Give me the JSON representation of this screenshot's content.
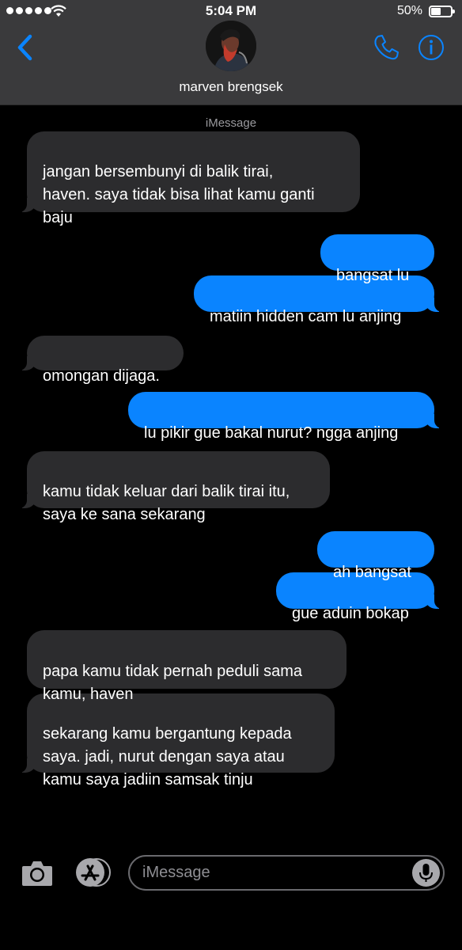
{
  "status_bar": {
    "time": "5:04 PM",
    "battery": "50%"
  },
  "header": {
    "contact_name": "marven brengsek"
  },
  "service_label": "iMessage",
  "messages": [
    {
      "dir": "in",
      "text": "jangan bersembunyi di balik tirai,\nhaven. saya tidak bisa lihat kamu ganti\nbaju"
    },
    {
      "dir": "out",
      "text": "bangsat lu"
    },
    {
      "dir": "out",
      "text": "matiin hidden cam lu anjing"
    },
    {
      "dir": "in",
      "text": "omongan dijaga."
    },
    {
      "dir": "out",
      "text": "lu pikir gue bakal nurut? ngga anjing"
    },
    {
      "dir": "in",
      "text": "kamu tidak keluar dari balik tirai itu,\nsaya ke sana sekarang"
    },
    {
      "dir": "out",
      "text": "ah bangsat"
    },
    {
      "dir": "out",
      "text": "gue aduin bokap"
    },
    {
      "dir": "in",
      "text": "papa kamu tidak pernah peduli sama\nkamu, haven"
    },
    {
      "dir": "in",
      "text": "sekarang kamu bergantung kepada\nsaya. jadi, nurut dengan saya atau\nkamu saya jadiin samsak tinju"
    }
  ],
  "compose": {
    "placeholder": "iMessage"
  },
  "colors": {
    "header_bg": "#3a3a3c",
    "incoming": "#2c2c2e",
    "outgoing": "#0a84ff",
    "accent": "#0a84ff"
  }
}
